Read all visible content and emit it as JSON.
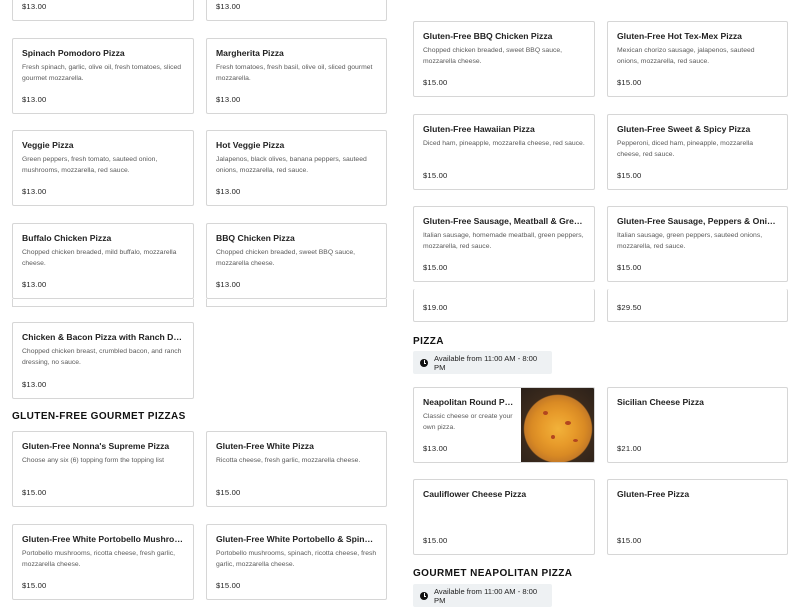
{
  "left_column": {
    "top_partial_cards": [
      {
        "price": "$13.00"
      },
      {
        "price": "$13.00"
      }
    ],
    "cards": [
      {
        "name": "Spinach Pomodoro Pizza",
        "desc": "Fresh spinach, garlic, olive oil, fresh tomatoes, sliced gourmet mozzarella.",
        "price": "$13.00"
      },
      {
        "name": "Margherita Pizza",
        "desc": "Fresh tomatoes, fresh basil, olive oil, sliced gourmet mozzarella.",
        "price": "$13.00"
      },
      {
        "name": "Veggie Pizza",
        "desc": "Green peppers, fresh tomato, sauteed onion, mushrooms, mozzarella, red sauce.",
        "price": "$13.00"
      },
      {
        "name": "Hot Veggie Pizza",
        "desc": "Jalapenos, black olives, banana peppers, sauteed onions, mozzarella, red sauce.",
        "price": "$13.00"
      },
      {
        "name": "Buffalo Chicken Pizza",
        "desc": "Chopped chicken breaded, mild buffalo, mozzarella cheese.",
        "price": "$13.00"
      },
      {
        "name": "BBQ Chicken Pizza",
        "desc": "Chopped chicken breaded, sweet BBQ sauce, mozzarella cheese.",
        "price": "$13.00"
      },
      {
        "name": "Chicken & Bacon Pizza with Ranch Dressing",
        "desc": "Chopped chicken breast, crumbled bacon, and ranch dressing, no sauce.",
        "price": "$13.00"
      }
    ],
    "gf_gourmet_title": "GLUTEN-FREE GOURMET PIZZAS",
    "gf_cards": [
      {
        "name": "Gluten-Free Nonna's Supreme Pizza",
        "desc": "Choose any six (6) topping form the topping list",
        "price": "$15.00"
      },
      {
        "name": "Gluten-Free White Pizza",
        "desc": "Ricotta cheese, fresh garlic, mozzarella cheese.",
        "price": "$15.00"
      },
      {
        "name": "Gluten-Free White Portobello Mushroom Pizza",
        "desc": "Portobello mushrooms, ricotta cheese, fresh garlic, mozzarella cheese.",
        "price": "$15.00"
      },
      {
        "name": "Gluten-Free White Portobello & Spinach Pizza",
        "desc": "Portobello mushrooms, spinach, ricotta cheese, fresh garlic, mozzarella cheese.",
        "price": "$15.00"
      }
    ]
  },
  "right_column": {
    "cards": [
      {
        "name": "Gluten-Free BBQ Chicken Pizza",
        "desc": "Chopped chicken breaded, sweet BBQ sauce, mozzarella cheese.",
        "price": "$15.00"
      },
      {
        "name": "Gluten-Free Hot Tex-Mex Pizza",
        "desc": "Mexican chorizo sausage, jalapenos, sauteed onions, mozzarella, red sauce.",
        "price": "$15.00"
      },
      {
        "name": "Gluten-Free Hawaiian Pizza",
        "desc": "Diced ham, pineapple, mozzarella cheese, red sauce.",
        "price": "$15.00"
      },
      {
        "name": "Gluten-Free Sweet & Spicy Pizza",
        "desc": "Pepperoni, diced ham, pineapple, mozzarella cheese, red sauce.",
        "price": "$15.00"
      },
      {
        "name": "Gluten-Free Sausage, Meatball & Green Peppers Pizza",
        "desc": "Italian sausage, homemade meatball, green peppers, mozzarella, red sauce.",
        "price": "$15.00"
      },
      {
        "name": "Gluten-Free Sausage, Peppers & Onions Pizza",
        "desc": "Italian sausage, green peppers, sauteed onions, mozzarella, red sauce.",
        "price": "$15.00"
      }
    ],
    "partial_cards": [
      {
        "price": "$19.00"
      },
      {
        "price": "$29.50"
      }
    ],
    "pizza_section": {
      "title": "PIZZA",
      "availability": "Available from 11:00 AM - 8:00 PM",
      "cards": [
        {
          "name": "Neapolitan Round Pizza",
          "desc": "Classic cheese or create your own pizza.",
          "price": "$13.00",
          "has_image": true
        },
        {
          "name": "Sicilian Cheese Pizza",
          "desc": "",
          "price": "$21.00"
        },
        {
          "name": "Cauliflower Cheese Pizza",
          "desc": "",
          "price": "$15.00"
        },
        {
          "name": "Gluten-Free Pizza",
          "desc": "",
          "price": "$15.00"
        }
      ]
    },
    "gourmet_neapolitan": {
      "title": "GOURMET NEAPOLITAN PIZZA",
      "availability": "Available from 11:00 AM - 8:00 PM"
    }
  },
  "icons": {
    "availability": "clock-icon"
  }
}
